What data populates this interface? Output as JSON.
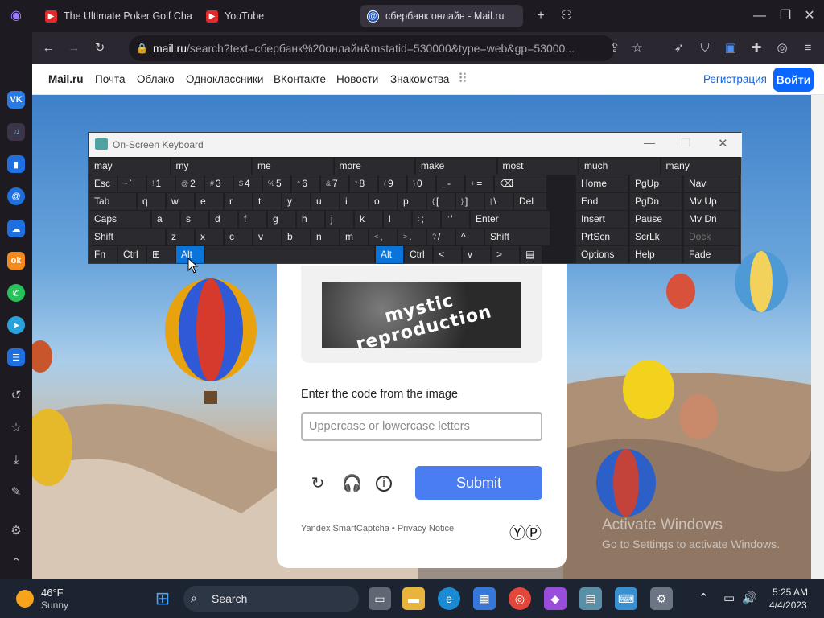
{
  "browser": {
    "tabs": [
      {
        "title": "The Ultimate Poker Golf Cha",
        "icon": "youtube-icon"
      },
      {
        "title": "YouTube",
        "icon": "youtube-icon"
      },
      {
        "title": "сбербанк онлайн - Mail.ru",
        "icon": "mailru-icon"
      }
    ],
    "address": {
      "domain": "mail.ru",
      "path": "/search?text=сбербанк%20онлайн&mstatid=530000&type=web&gp=53000..."
    }
  },
  "mail_header": {
    "brand": "Mail.ru",
    "nav": [
      "Почта",
      "Облако",
      "Одноклассники",
      "ВКонтакте",
      "Новости",
      "Знакомства"
    ],
    "register": "Регистрация",
    "login": "Войти"
  },
  "captcha": {
    "image_text": "mystic reproduction",
    "prompt": "Enter the code from the image",
    "placeholder": "Uppercase or lowercase letters",
    "submit": "Submit",
    "footer": "Yandex SmartCaptcha • Privacy Notice"
  },
  "osk": {
    "title": "On-Screen Keyboard",
    "predictions": [
      "may",
      "my",
      "me",
      "more",
      "make",
      "most",
      "much",
      "many"
    ],
    "rows": [
      [
        {
          "l": "Esc"
        },
        {
          "s": "~",
          "l": "`"
        },
        {
          "s": "!",
          "l": "1"
        },
        {
          "s": "@",
          "l": "2"
        },
        {
          "s": "#",
          "l": "3"
        },
        {
          "s": "$",
          "l": "4"
        },
        {
          "s": "%",
          "l": "5"
        },
        {
          "s": "^",
          "l": "6"
        },
        {
          "s": "&",
          "l": "7"
        },
        {
          "s": "*",
          "l": "8"
        },
        {
          "s": "(",
          "l": "9"
        },
        {
          "s": ")",
          "l": "0"
        },
        {
          "s": "_",
          "l": "-"
        },
        {
          "s": "+",
          "l": "="
        },
        {
          "l": "⌫"
        }
      ],
      [
        {
          "l": "Tab"
        },
        {
          "l": "q"
        },
        {
          "l": "w"
        },
        {
          "l": "e"
        },
        {
          "l": "r"
        },
        {
          "l": "t"
        },
        {
          "l": "y"
        },
        {
          "l": "u"
        },
        {
          "l": "i"
        },
        {
          "l": "o"
        },
        {
          "l": "p"
        },
        {
          "s": "{",
          "l": "["
        },
        {
          "s": "}",
          "l": "]"
        },
        {
          "s": "|",
          "l": "\\"
        },
        {
          "l": "Del"
        }
      ],
      [
        {
          "l": "Caps"
        },
        {
          "l": "a"
        },
        {
          "l": "s"
        },
        {
          "l": "d"
        },
        {
          "l": "f"
        },
        {
          "l": "g"
        },
        {
          "l": "h"
        },
        {
          "l": "j"
        },
        {
          "l": "k"
        },
        {
          "l": "l"
        },
        {
          "s": ":",
          "l": ";"
        },
        {
          "s": "\"",
          "l": "'"
        },
        {
          "l": "Enter"
        }
      ],
      [
        {
          "l": "Shift"
        },
        {
          "l": "z"
        },
        {
          "l": "x"
        },
        {
          "l": "c"
        },
        {
          "l": "v"
        },
        {
          "l": "b"
        },
        {
          "l": "n"
        },
        {
          "l": "m"
        },
        {
          "s": "<",
          "l": ","
        },
        {
          "s": ">",
          "l": "."
        },
        {
          "s": "?",
          "l": "/"
        },
        {
          "l": "^"
        },
        {
          "l": "Shift"
        }
      ],
      [
        {
          "l": "Fn"
        },
        {
          "l": "Ctrl"
        },
        {
          "l": "⊞"
        },
        {
          "l": "Alt",
          "active": true
        },
        {
          "l": ""
        },
        {
          "l": "Alt",
          "active": true
        },
        {
          "l": "Ctrl"
        },
        {
          "l": "<"
        },
        {
          "l": "v"
        },
        {
          "l": ">"
        },
        {
          "l": "▤"
        }
      ]
    ],
    "side": [
      [
        "Home",
        "PgUp",
        "Nav"
      ],
      [
        "End",
        "PgDn",
        "Mv Up"
      ],
      [
        "Insert",
        "Pause",
        "Mv Dn"
      ],
      [
        "PrtScn",
        "ScrLk",
        "Dock"
      ],
      [
        "Options",
        "Help",
        "Fade"
      ]
    ]
  },
  "watermark": {
    "line1": "Activate Windows",
    "line2": "Go to Settings to activate Windows."
  },
  "taskbar": {
    "weather_temp": "46°F",
    "weather_desc": "Sunny",
    "search": "Search",
    "time": "5:25 AM",
    "date": "4/4/2023"
  },
  "colors": {
    "accent": "#0a66ff",
    "submit": "#4a7cf2",
    "osk_active": "#0a74d9"
  }
}
